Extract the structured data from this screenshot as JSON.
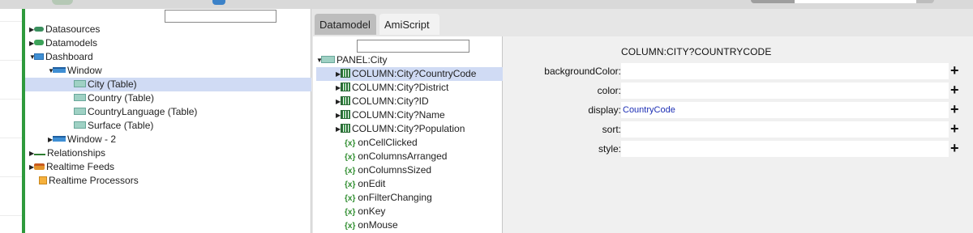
{
  "tree": {
    "search_value": "",
    "items": [
      {
        "label": "Datasources",
        "icon": "database-icon",
        "expanded": false
      },
      {
        "label": "Datamodels",
        "icon": "datamodel-icon",
        "expanded": false
      },
      {
        "label": "Dashboard",
        "icon": "monitor-icon",
        "expanded": true
      },
      {
        "label": "Window",
        "icon": "window-icon",
        "expanded": true
      },
      {
        "label": "City (Table)",
        "icon": "table-icon",
        "selected": true
      },
      {
        "label": "Country (Table)",
        "icon": "table-icon"
      },
      {
        "label": "CountryLanguage (Table)",
        "icon": "table-icon"
      },
      {
        "label": "Surface (Table)",
        "icon": "table-icon"
      },
      {
        "label": "Window - 2",
        "icon": "window-icon",
        "expanded": false
      },
      {
        "label": "Relationships",
        "icon": "relationship-icon",
        "expanded": false
      },
      {
        "label": "Realtime Feeds",
        "icon": "feed-icon",
        "expanded": false
      },
      {
        "label": "Realtime Processors",
        "icon": "processor-icon"
      }
    ]
  },
  "tabs": [
    {
      "label": "Datamodel",
      "active": true
    },
    {
      "label": "AmiScript",
      "active": false
    }
  ],
  "members": {
    "search_value": "",
    "items": [
      {
        "label": "PANEL:City",
        "icon": "panel-icon",
        "expanded": true
      },
      {
        "label": "COLUMN:City?CountryCode",
        "icon": "column-icon",
        "selected": true
      },
      {
        "label": "COLUMN:City?District",
        "icon": "column-icon"
      },
      {
        "label": "COLUMN:City?ID",
        "icon": "column-icon"
      },
      {
        "label": "COLUMN:City?Name",
        "icon": "column-icon"
      },
      {
        "label": "COLUMN:City?Population",
        "icon": "column-icon"
      },
      {
        "label": "onCellClicked",
        "icon": "function-icon"
      },
      {
        "label": "onColumnsArranged",
        "icon": "function-icon"
      },
      {
        "label": "onColumnsSized",
        "icon": "function-icon"
      },
      {
        "label": "onEdit",
        "icon": "function-icon"
      },
      {
        "label": "onFilterChanging",
        "icon": "function-icon"
      },
      {
        "label": "onKey",
        "icon": "function-icon"
      },
      {
        "label": "onMouse",
        "icon": "function-icon"
      }
    ]
  },
  "properties": {
    "title": "COLUMN:CITY?COUNTRYCODE",
    "rows": [
      {
        "label": "backgroundColor:",
        "value": ""
      },
      {
        "label": "color:",
        "value": ""
      },
      {
        "label": "display:",
        "value": "CountryCode"
      },
      {
        "label": "sort:",
        "value": ""
      },
      {
        "label": "style:",
        "value": ""
      }
    ],
    "add_symbol": "+"
  },
  "colors": {
    "accent_green": "#2e9a3c",
    "selection": "#d0dbf4",
    "value_text": "#1d2fb5"
  }
}
